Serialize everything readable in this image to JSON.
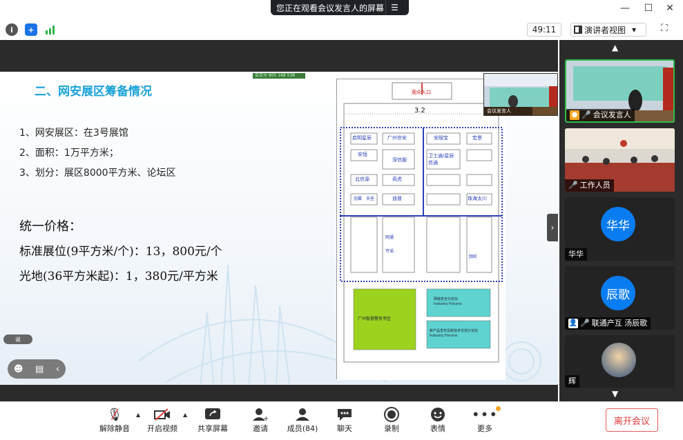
{
  "topbar": {
    "sharing_text": "您正在观看会议发言人的屏幕",
    "menu_icon": "list-icon"
  },
  "window": {
    "minimize": "—",
    "maximize": "☐",
    "close": "✕"
  },
  "infobar": {
    "timer": "49:11",
    "view_label": "演讲者视图"
  },
  "slide": {
    "title": "二、网安展区筹备情况",
    "lines": [
      "1、网安展区：在3号展馆",
      "2、面积：1万平方米；",
      "3、划分：展区8000平方米、论坛区"
    ],
    "price_title": "统一价格：",
    "price1": "标准展位(9平方米/个)：13，800元/个",
    "price2": "光地(36平方米起)：1，380元/平方米",
    "mini_badge": "会议号 805 168 538",
    "floorplan": {
      "entrance": "观众入口",
      "hall": "3.2",
      "booths": [
        "启明星辰",
        "广州世安",
        "安赋宝",
        "宏景",
        "安恒",
        "深信服",
        "卫士通/星辰信通",
        "北信源",
        "奇虎",
        "迪普",
        "珠海太川",
        "羽翼",
        "天垒",
        "网通",
        "夺诺",
        "顶固"
      ],
      "zone_green": "广州智慧警务专区",
      "zone_cyan1": "网络安全分论坛\nIndustry Forums",
      "zone_cyan2": "新产品发布及新技术交流分论坛\nIndustry Forums"
    },
    "inset_label": "会议发言人"
  },
  "chat_chip": "说",
  "panel": {
    "tiles": [
      {
        "label": "会议发言人",
        "type": "video"
      },
      {
        "label": "工作人员",
        "type": "video"
      },
      {
        "label": "华华",
        "avatar": "华华",
        "type": "avatar"
      },
      {
        "label": "联通产互 汤辰歌",
        "avatar": "辰歌",
        "type": "avatar"
      },
      {
        "label": "辉",
        "type": "photo"
      }
    ]
  },
  "toolbar": {
    "items": [
      {
        "label": "解除静音",
        "icon": "mic-muted-icon"
      },
      {
        "label": "开启视频",
        "icon": "video-off-icon"
      },
      {
        "label": "共享屏幕",
        "icon": "share-screen-icon"
      },
      {
        "label": "邀请",
        "icon": "invite-icon"
      },
      {
        "label": "成员(84)",
        "icon": "members-icon"
      },
      {
        "label": "聊天",
        "icon": "chat-icon"
      },
      {
        "label": "录制",
        "icon": "record-icon"
      },
      {
        "label": "表情",
        "icon": "emoji-icon"
      },
      {
        "label": "更多",
        "icon": "more-icon"
      }
    ],
    "leave": "离开会议"
  },
  "colors": {
    "accent": "#0a7cf2",
    "active_border": "#2fbf4a",
    "leave": "#e03c3c",
    "slide_title": "#19a3d8"
  }
}
